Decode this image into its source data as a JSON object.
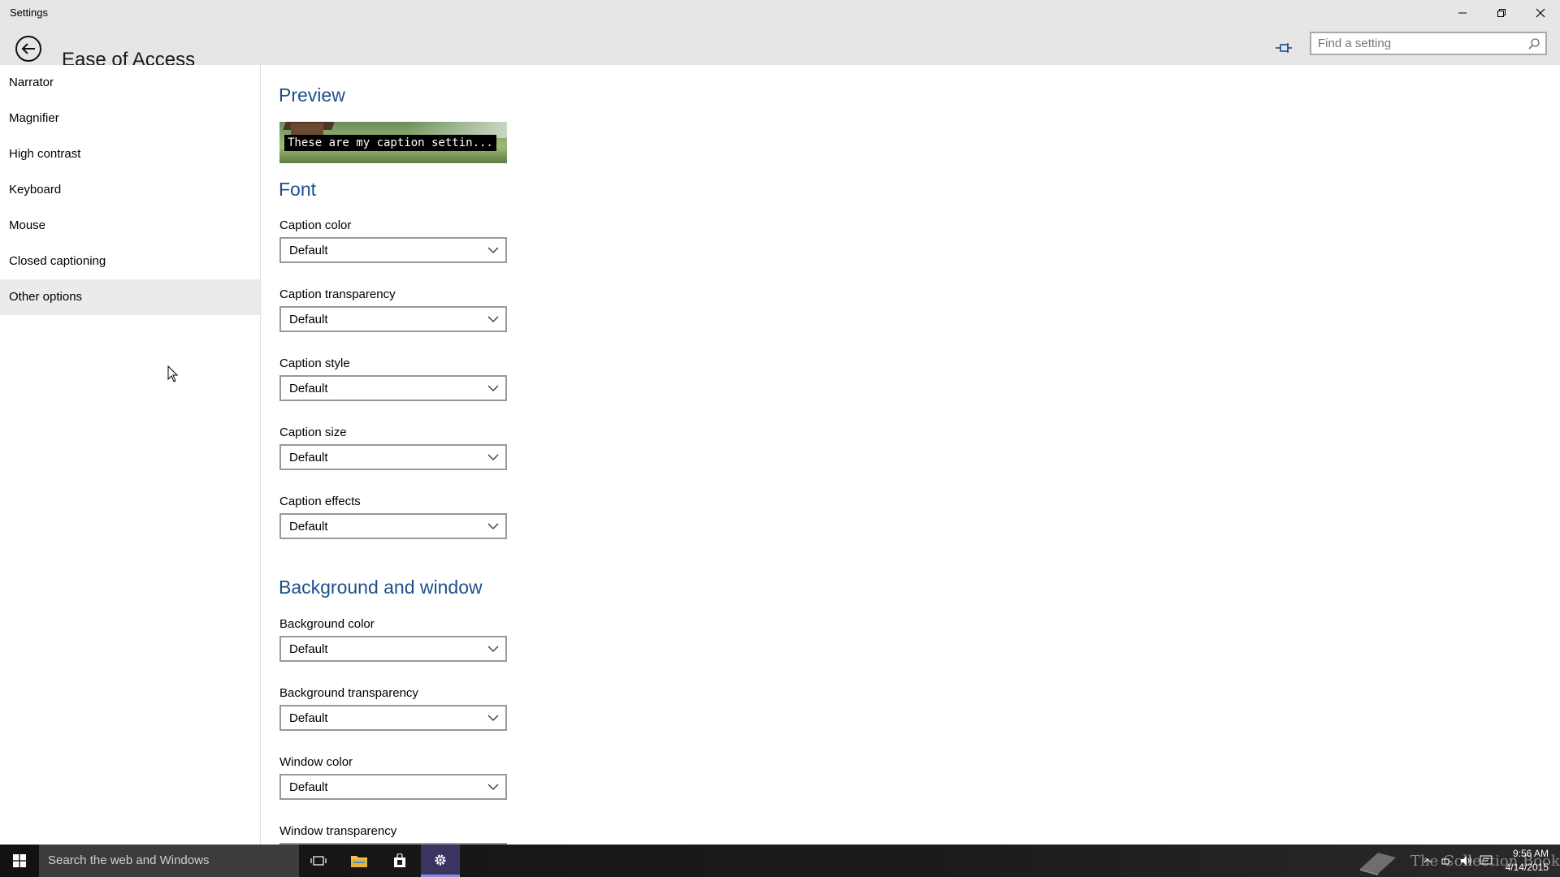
{
  "window": {
    "app_title": "Settings",
    "controls": [
      "minimize",
      "restore",
      "close"
    ]
  },
  "header": {
    "title": "Ease of Access",
    "search_placeholder": "Find a setting"
  },
  "sidebar": {
    "items": [
      {
        "label": "Narrator"
      },
      {
        "label": "Magnifier"
      },
      {
        "label": "High contrast"
      },
      {
        "label": "Keyboard"
      },
      {
        "label": "Mouse"
      },
      {
        "label": "Closed captioning"
      },
      {
        "label": "Other options"
      }
    ],
    "hovered": "Other options"
  },
  "preview": {
    "title": "Preview",
    "caption_text": "These are my caption settin..."
  },
  "font_section": {
    "title": "Font",
    "fields": [
      {
        "label": "Caption color",
        "value": "Default"
      },
      {
        "label": "Caption transparency",
        "value": "Default"
      },
      {
        "label": "Caption style",
        "value": "Default"
      },
      {
        "label": "Caption size",
        "value": "Default"
      },
      {
        "label": "Caption effects",
        "value": "Default"
      }
    ]
  },
  "background_section": {
    "title": "Background and window",
    "fields": [
      {
        "label": "Background color",
        "value": "Default"
      },
      {
        "label": "Background transparency",
        "value": "Default"
      },
      {
        "label": "Window color",
        "value": "Default"
      },
      {
        "label": "Window transparency",
        "value": ""
      }
    ]
  },
  "taskbar": {
    "search_placeholder": "Search the web and Windows",
    "watermark": "The Collection Book",
    "time": "9:56 AM",
    "date": "4/14/2015"
  },
  "colors": {
    "accent": "#1d4f8c",
    "header_bg": "#e6e6e6",
    "taskbar_bg": "#1b1b1b",
    "active_app": "#3a3560"
  }
}
